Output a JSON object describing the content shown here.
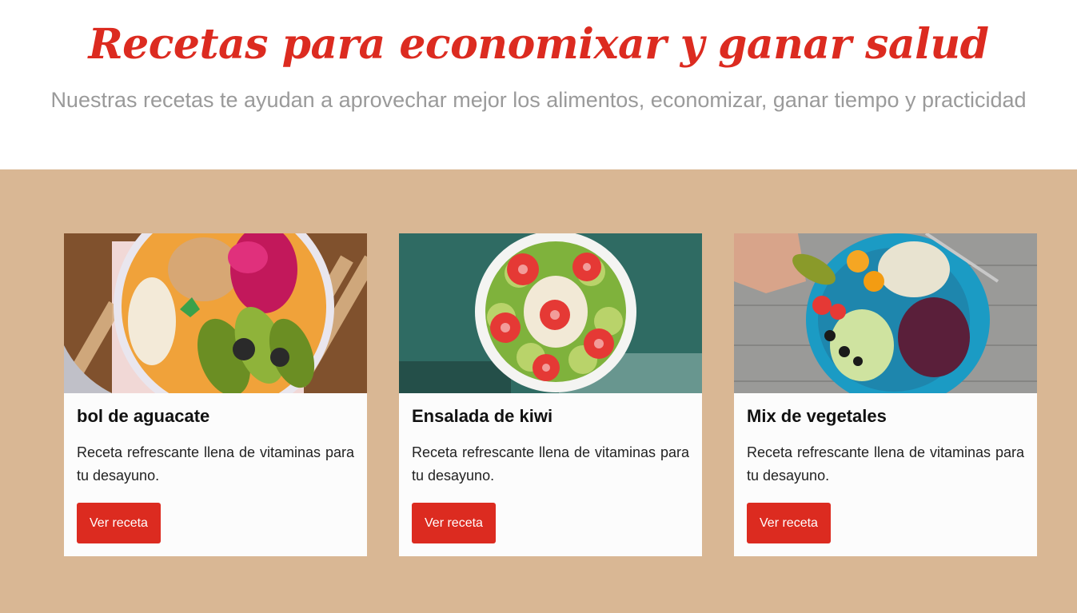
{
  "header": {
    "title": "Recetas para economixar y ganar salud",
    "subtitle": "Nuestras recetas te ayudan a aprovechar mejor los alimentos, economizar, ganar tiempo y practicidad"
  },
  "colors": {
    "accent": "#dc2b20",
    "band": "#d9b794",
    "card": "#fcfcfc"
  },
  "cards": [
    {
      "title": "bol de aguacate",
      "description": "Receta refrescante llena de vitaminas para tu desayuno.",
      "button": "Ver receta",
      "image": "avocado-bowl-photo"
    },
    {
      "title": "Ensalada de kiwi",
      "description": "Receta refrescante llena de vitaminas para tu desayuno.",
      "button": "Ver receta",
      "image": "kiwi-salad-photo"
    },
    {
      "title": "Mix de vegetales",
      "description": "Receta refrescante llena de vitaminas para tu desayuno.",
      "button": "Ver receta",
      "image": "vegetable-mix-photo"
    }
  ]
}
